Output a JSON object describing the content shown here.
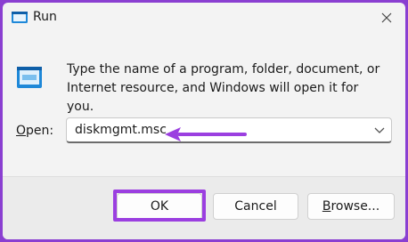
{
  "window": {
    "title": "Run"
  },
  "dialog": {
    "description_line1": "Type the name of a program, folder, document, or",
    "description_line2": "Internet resource, and Windows will open it for you.",
    "open_label_accel": "O",
    "open_label_rest": "pen:",
    "command_value": "diskmgmt.msc"
  },
  "buttons": {
    "ok": "OK",
    "cancel": "Cancel",
    "browse_accel": "B",
    "browse_rest": "rowse..."
  },
  "icons": {
    "title": "run-app-icon",
    "dialog": "run-app-icon",
    "close": "close-icon",
    "dropdown": "chevron-down-icon"
  },
  "colors": {
    "background_frame": "#8a3fd1",
    "annotation": "#9b3fe0",
    "icon_blue": "#1e88d8"
  }
}
